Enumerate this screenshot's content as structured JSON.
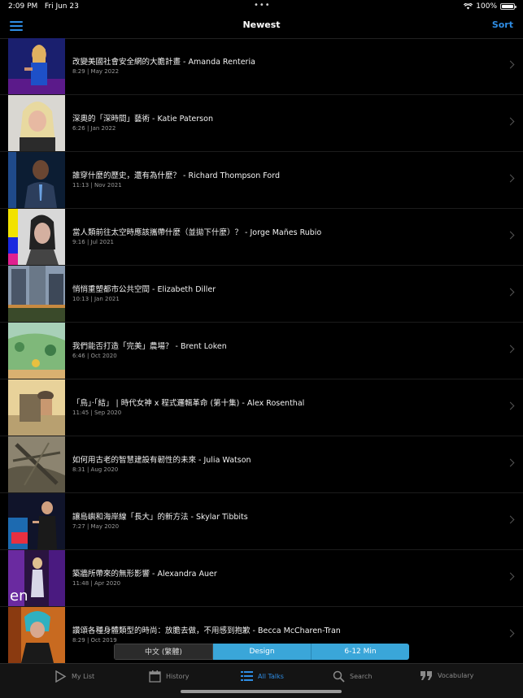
{
  "status": {
    "time": "2:09 PM",
    "date": "Fri Jun 23",
    "battery": "100%"
  },
  "nav": {
    "title": "Newest",
    "sort_label": "Sort"
  },
  "talks": [
    {
      "title": "改變美國社會安全網的大膽計畫 - Amanda Renteria",
      "meta": "8:29 | May 2022"
    },
    {
      "title": "深奧的「深時間」藝術 - Katie Paterson",
      "meta": "6:26 | Jan 2022"
    },
    {
      "title": "誰穿什麼的歷史，還有為什麼？ - Richard Thompson Ford",
      "meta": "11:13 | Nov 2021"
    },
    {
      "title": "當人類前往太空時應該攜帶什麼（並拋下什麼）？ - Jorge Mañes Rubio",
      "meta": "9:16 | Jul 2021"
    },
    {
      "title": "悄悄重塑都市公共空間 - Elizabeth Diller",
      "meta": "10:13 | Jan 2021"
    },
    {
      "title": "我們能否打造「完美」農場？ - Brent Loken",
      "meta": "6:46 | Oct 2020"
    },
    {
      "title": "「鳥」·「結」 | 時代女神 x 程式邏輯革命 (第十集) - Alex Rosenthal",
      "meta": "11:45 | Sep 2020"
    },
    {
      "title": "如何用古老的智慧建設有韌性的未來 - Julia Watson",
      "meta": "8:31 | Aug 2020"
    },
    {
      "title": "讓島嶼和海岸線「長大」的新方法 - Skylar Tibbits",
      "meta": "7:27 | May 2020"
    },
    {
      "title": "築牆所帶來的無形影響 - Alexandra Auer",
      "meta": "11:48 | Apr 2020"
    },
    {
      "title": "讚頌各種身體類型的時尚：放膽去做，不用感到抱歉 - Becca McCharen-Tran",
      "meta": "8:29 | Oct 2019"
    }
  ],
  "filters": {
    "language": "中文 (繁體)",
    "topic": "Design",
    "duration": "6-12 Min"
  },
  "tabs": [
    {
      "label": "My List",
      "icon": "play-icon"
    },
    {
      "label": "History",
      "icon": "calendar-icon"
    },
    {
      "label": "All Talks",
      "icon": "list-icon"
    },
    {
      "label": "Search",
      "icon": "search-icon"
    },
    {
      "label": "Vocabulary",
      "icon": "quote-icon"
    }
  ],
  "colors": {
    "accent": "#2f8de4",
    "segment": "#3aa6d9",
    "background": "#000000"
  }
}
